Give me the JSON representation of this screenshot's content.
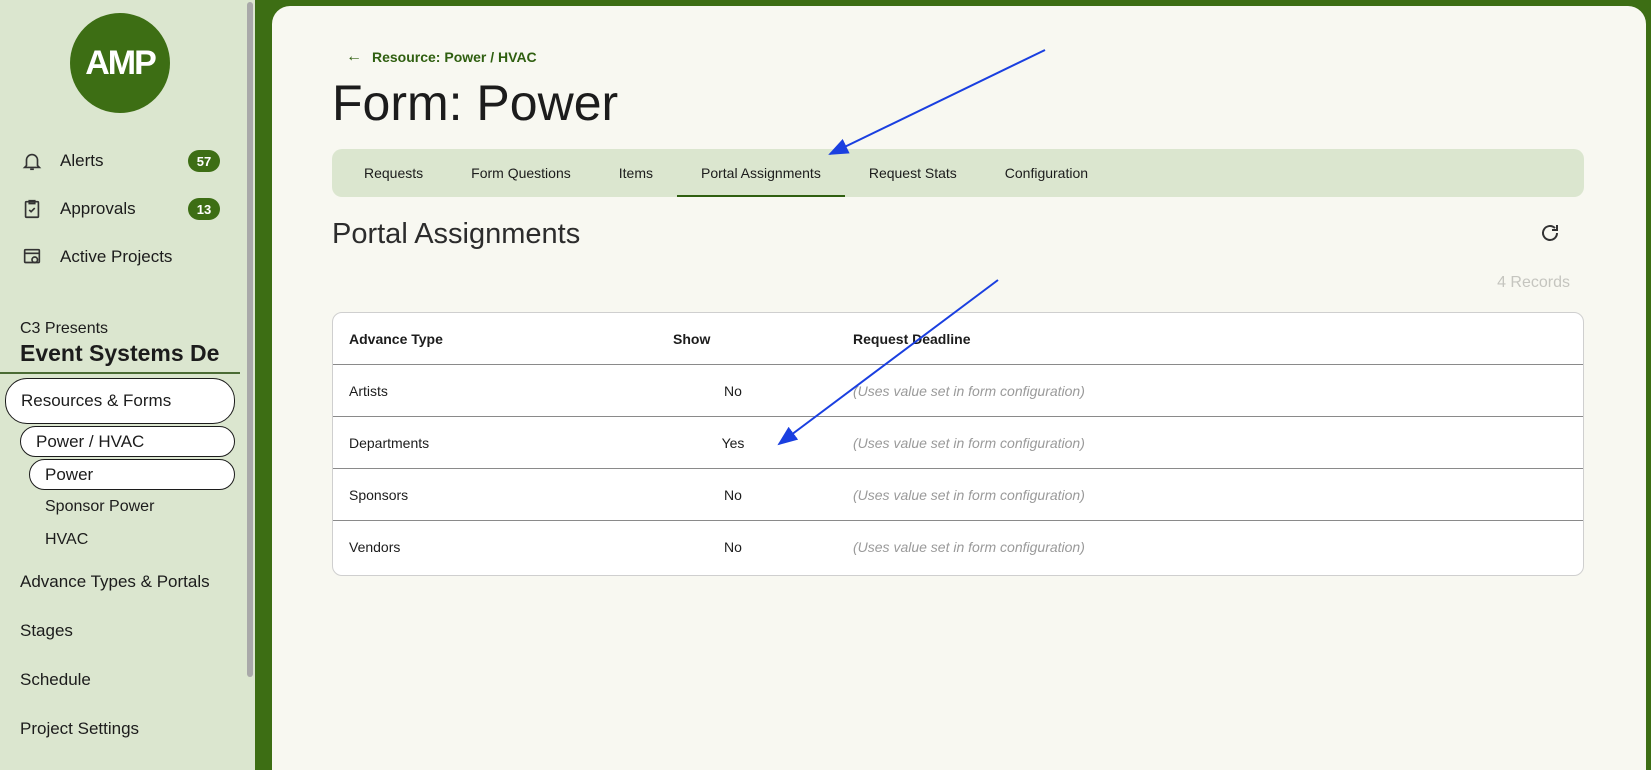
{
  "sidebar": {
    "logo_text": "AMP",
    "nav": [
      {
        "label": "Alerts",
        "icon": "bell-icon",
        "badge": "57"
      },
      {
        "label": "Approvals",
        "icon": "clipboard-check-icon",
        "badge": "13"
      },
      {
        "label": "Active Projects",
        "icon": "project-view-icon"
      }
    ],
    "org": "C3 Presents",
    "project": "Event Systems De",
    "resources_forms": "Resources & Forms",
    "power_hvac": "Power / HVAC",
    "power": "Power",
    "sponsor_power": "Sponsor Power",
    "hvac": "HVAC",
    "advance_types": "Advance Types & Portals",
    "stages": "Stages",
    "schedule": "Schedule",
    "project_settings": "Project Settings"
  },
  "main": {
    "breadcrumb": "Resource: Power / HVAC",
    "title": "Form: Power",
    "tabs": [
      {
        "label": "Requests"
      },
      {
        "label": "Form Questions"
      },
      {
        "label": "Items"
      },
      {
        "label": "Portal Assignments",
        "active": true
      },
      {
        "label": "Request Stats"
      },
      {
        "label": "Configuration"
      }
    ],
    "section_title": "Portal Assignments",
    "records": "4 Records",
    "table": {
      "headers": {
        "type": "Advance Type",
        "show": "Show",
        "deadline": "Request Deadline"
      },
      "rows": [
        {
          "type": "Artists",
          "show": "No",
          "deadline": "(Uses value set in form configuration)"
        },
        {
          "type": "Departments",
          "show": "Yes",
          "deadline": "(Uses value set in form configuration)"
        },
        {
          "type": "Sponsors",
          "show": "No",
          "deadline": "(Uses value set in form configuration)"
        },
        {
          "type": "Vendors",
          "show": "No",
          "deadline": "(Uses value set in form configuration)"
        }
      ]
    }
  },
  "colors": {
    "brand": "#3d6e14",
    "annotation_arrow": "#1a3fe0"
  }
}
